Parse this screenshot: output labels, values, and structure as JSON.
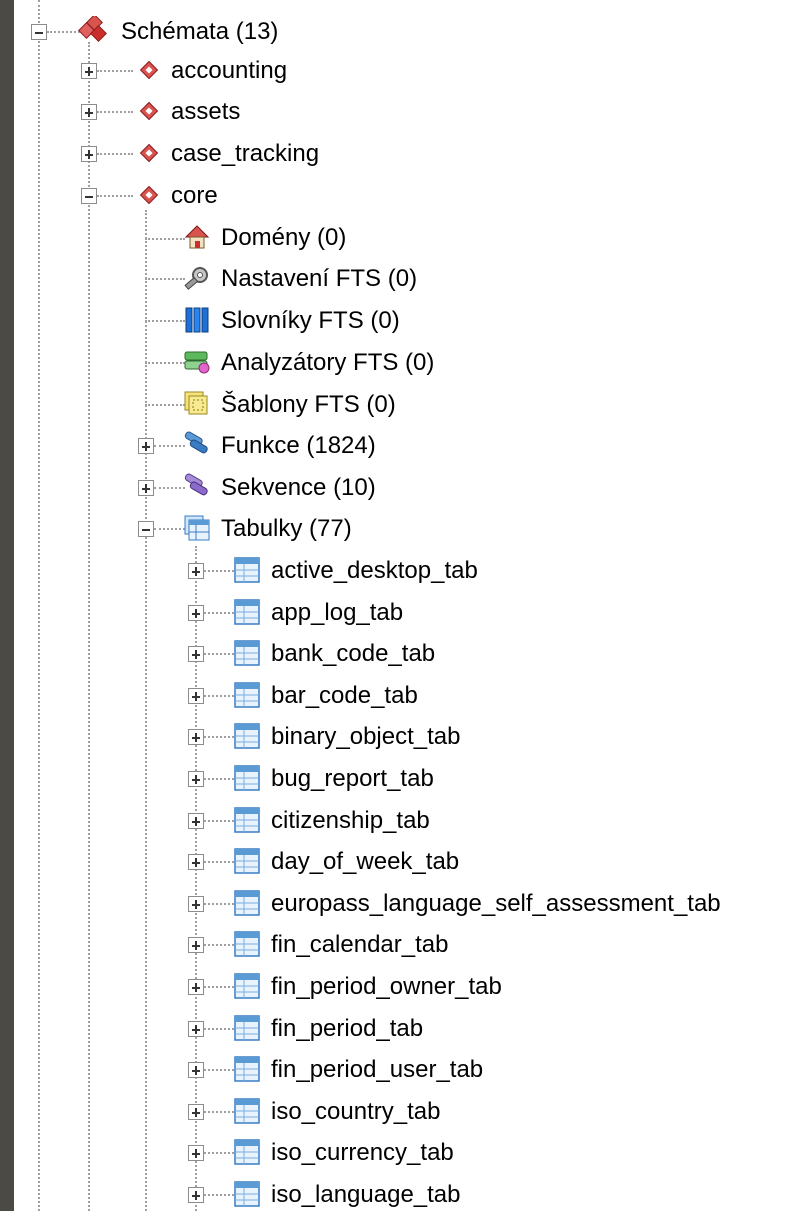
{
  "tree": {
    "root": {
      "label": "Schémata (13)",
      "icon": "schemas-icon",
      "expanded": true
    },
    "schemas": [
      {
        "label": "accounting",
        "icon": "schema-icon",
        "expanded": false
      },
      {
        "label": "assets",
        "icon": "schema-icon",
        "expanded": false
      },
      {
        "label": "case_tracking",
        "icon": "schema-icon",
        "expanded": false
      },
      {
        "label": "core",
        "icon": "schema-icon",
        "expanded": true
      }
    ],
    "core_children": [
      {
        "label": "Domény (0)",
        "icon": "domains-icon"
      },
      {
        "label": "Nastavení FTS (0)",
        "icon": "fts-settings-icon"
      },
      {
        "label": "Slovníky FTS (0)",
        "icon": "fts-dictionaries-icon"
      },
      {
        "label": "Analyzátory FTS (0)",
        "icon": "fts-parsers-icon"
      },
      {
        "label": "Šablony FTS (0)",
        "icon": "fts-templates-icon"
      },
      {
        "label": "Funkce (1824)",
        "icon": "functions-icon",
        "expanded": false
      },
      {
        "label": "Sekvence (10)",
        "icon": "sequences-icon",
        "expanded": false
      },
      {
        "label": "Tabulky (77)",
        "icon": "tables-icon",
        "expanded": true
      }
    ],
    "tables": [
      "active_desktop_tab",
      "app_log_tab",
      "bank_code_tab",
      "bar_code_tab",
      "binary_object_tab",
      "bug_report_tab",
      "citizenship_tab",
      "day_of_week_tab",
      "europass_language_self_assessment_tab",
      "fin_calendar_tab",
      "fin_period_owner_tab",
      "fin_period_tab",
      "fin_period_user_tab",
      "iso_country_tab",
      "iso_currency_tab",
      "iso_language_tab"
    ]
  }
}
